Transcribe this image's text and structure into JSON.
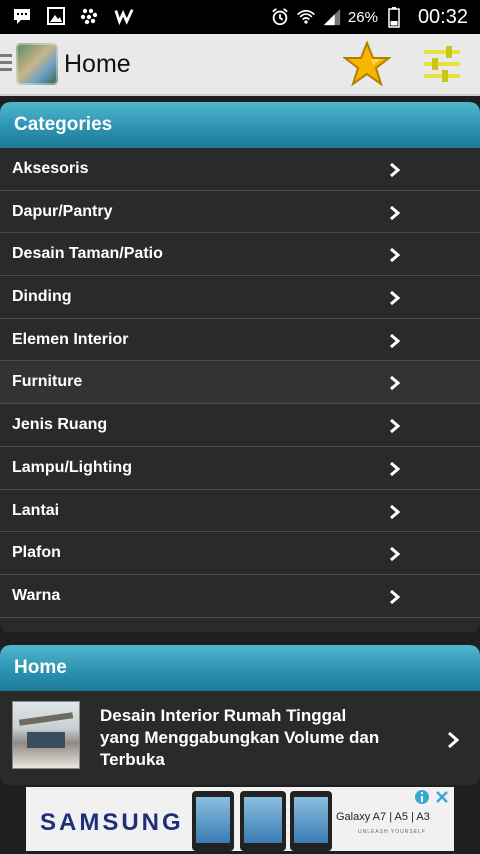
{
  "status_bar": {
    "icons": [
      "chat-icon",
      "image-icon",
      "blackberry-icon",
      "w-app-icon",
      "alarm-icon",
      "wifi-icon",
      "signal-icon",
      "battery-icon"
    ],
    "battery": "26%",
    "time": "00:32"
  },
  "action_bar": {
    "title": "Home",
    "accent": "#f5b800"
  },
  "categories": {
    "header": "Categories",
    "items": [
      {
        "label": "Aksesoris"
      },
      {
        "label": "Dapur/Pantry"
      },
      {
        "label": "Desain Taman/Patio"
      },
      {
        "label": "Dinding"
      },
      {
        "label": "Elemen Interior"
      },
      {
        "label": "Furniture"
      },
      {
        "label": "Jenis Ruang"
      },
      {
        "label": "Lampu/Lighting"
      },
      {
        "label": "Lantai"
      },
      {
        "label": "Plafon"
      },
      {
        "label": "Warna"
      }
    ]
  },
  "home": {
    "header": "Home",
    "article": {
      "title": "Desain Interior Rumah Tinggal yang Menggabungkan Volume dan Terbuka"
    }
  },
  "ad": {
    "brand": "SAMSUNG",
    "models": "Galaxy A7 | A5 | A3",
    "tagline": "UNLEASH YOURSELF"
  },
  "colors": {
    "header_gradient_top": "#52b6cf",
    "header_gradient_bottom": "#1d7a98",
    "list_background": "#2a2a2a"
  }
}
